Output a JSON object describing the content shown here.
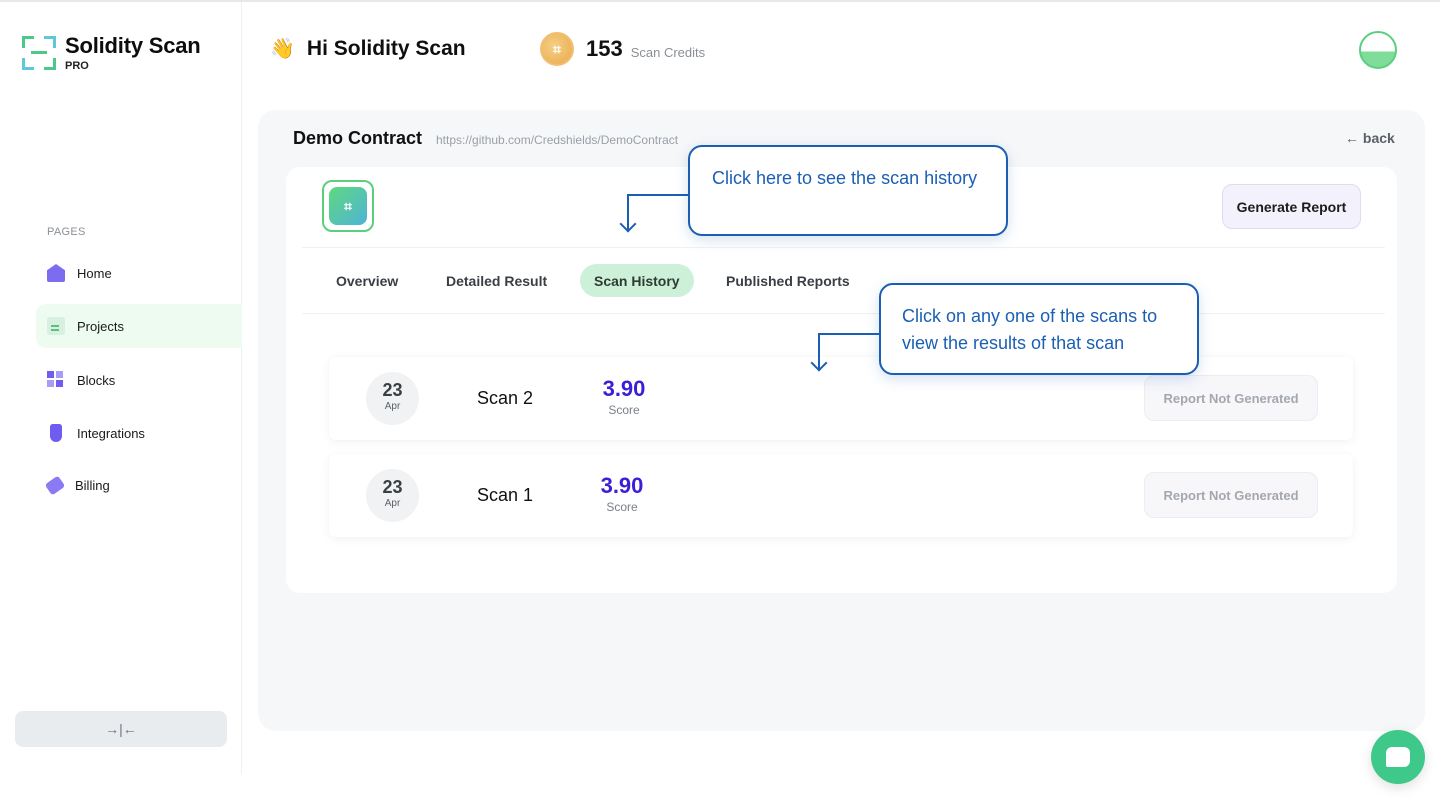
{
  "app": {
    "name": "Solidity Scan",
    "tier": "PRO"
  },
  "sidebar": {
    "section_label": "PAGES",
    "items": [
      {
        "label": "Home",
        "icon": "home-icon"
      },
      {
        "label": "Projects",
        "icon": "projects-icon",
        "active": true
      },
      {
        "label": "Blocks",
        "icon": "blocks-icon"
      },
      {
        "label": "Integrations",
        "icon": "integrations-icon"
      },
      {
        "label": "Billing",
        "icon": "billing-icon"
      }
    ],
    "collapse_glyph": "→|←"
  },
  "header": {
    "wave_emoji": "👋",
    "greeting": "Hi Solidity Scan",
    "credits_count": "153",
    "credits_label": "Scan Credits"
  },
  "contract": {
    "name": "Demo Contract",
    "url": "https://github.com/Credshields/DemoContract",
    "back_label": "← back",
    "generate_report_label": "Generate Report"
  },
  "tabs": [
    {
      "label": "Overview"
    },
    {
      "label": "Detailed Result"
    },
    {
      "label": "Scan History",
      "active": true
    },
    {
      "label": "Published Reports"
    }
  ],
  "scans": [
    {
      "day": "23",
      "month": "Apr",
      "name": "Scan 2",
      "score": "3.90",
      "score_label": "Score",
      "report_status": "Report Not Generated"
    },
    {
      "day": "23",
      "month": "Apr",
      "name": "Scan 1",
      "score": "3.90",
      "score_label": "Score",
      "report_status": "Report Not Generated"
    }
  ],
  "callouts": {
    "history": "Click here to see the scan history",
    "scans": "Click on any one of the scans to view the results of that scan"
  },
  "colors": {
    "accent_green": "#5ccf7e",
    "score_purple": "#3a1fd6",
    "callout_blue": "#1a5fb4",
    "active_tab_bg": "#cdf0d8"
  }
}
